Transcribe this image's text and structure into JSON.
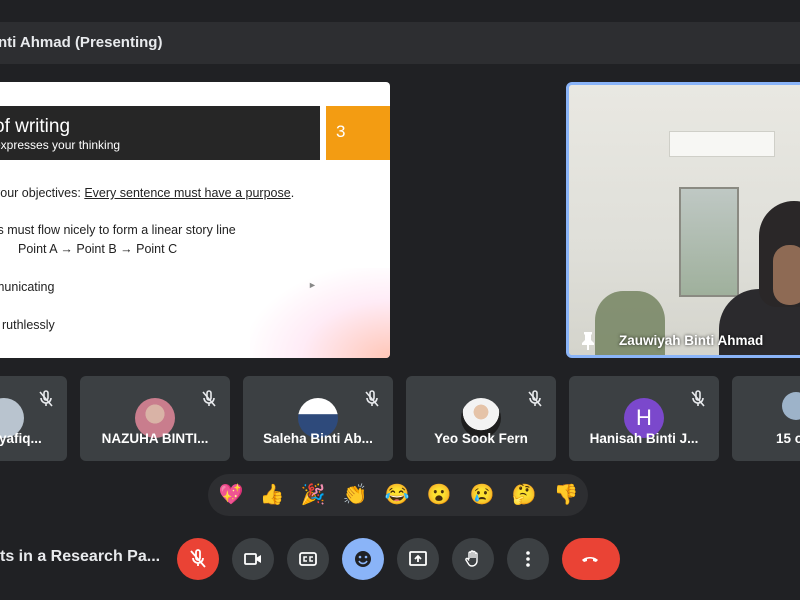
{
  "header": {
    "presenting_label": "nti Ahmad (Presenting)"
  },
  "slide": {
    "title": "of writing",
    "subtitle": "expresses your thinking",
    "number": "3",
    "line1_prefix": "your objectives: ",
    "line1_underlined": "Every sentence must have a purpose",
    "line1_suffix": ".",
    "line2": "ts must flow nicely to form a linear story line",
    "line3": "Point A → Point B → Point C",
    "line4": "municating",
    "line5": "ruthlessly"
  },
  "speaker": {
    "name": "Zauwiyah Binti Ahmad",
    "pin_icon": "pin-icon"
  },
  "participants": [
    {
      "name": "Syafiq...",
      "avatar": "photo",
      "muted": true
    },
    {
      "name": "NAZUHA BINTI...",
      "avatar": "photo",
      "muted": true
    },
    {
      "name": "Saleha Binti Ab...",
      "avatar": "photo",
      "muted": true
    },
    {
      "name": "Yeo Sook Fern",
      "avatar": "photo",
      "muted": true
    },
    {
      "name": "Hanisah Binti J...",
      "avatar": "H",
      "avatar_color": "#7b48cc",
      "muted": true
    },
    {
      "name": "15 o",
      "avatar": "photo",
      "muted": false
    }
  ],
  "reactions": [
    {
      "name": "sparkling-heart",
      "glyph": "💖"
    },
    {
      "name": "thumbs-up",
      "glyph": "👍"
    },
    {
      "name": "party-popper",
      "glyph": "🎉"
    },
    {
      "name": "clapping-hands",
      "glyph": "👏"
    },
    {
      "name": "tears-of-joy",
      "glyph": "😂"
    },
    {
      "name": "surprised",
      "glyph": "😮"
    },
    {
      "name": "crying",
      "glyph": "😢"
    },
    {
      "name": "thinking",
      "glyph": "🤔"
    },
    {
      "name": "thumbs-down",
      "glyph": "👎"
    }
  ],
  "footer": {
    "meeting_title": "ts in a Research Pa..."
  },
  "colors": {
    "background": "#202124",
    "tile": "#3c4043",
    "danger": "#ea4335",
    "accent_blue": "#8ab4f8",
    "slide_number_box": "#f39c12"
  }
}
